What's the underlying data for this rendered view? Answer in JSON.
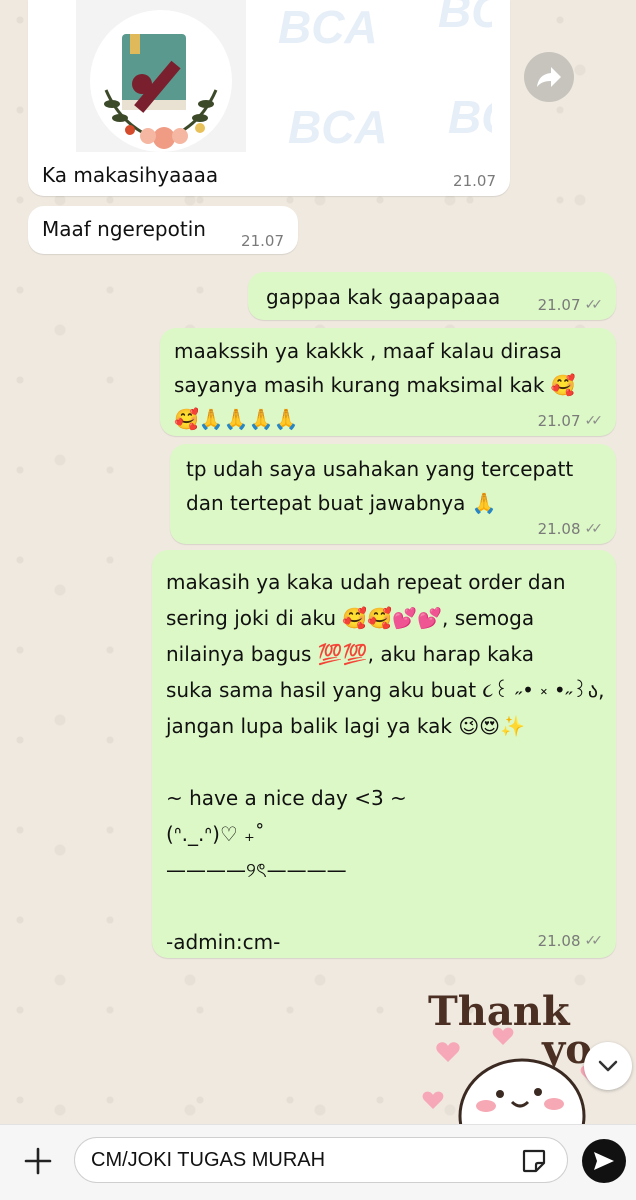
{
  "chat": {
    "messages": [
      {
        "direction": "in",
        "caption": "Ka makasihyaaaa",
        "time": "21.07",
        "image": {
          "watermark": "BCA"
        }
      },
      {
        "direction": "in",
        "text": "Maaf ngerepotin",
        "time": "21.07"
      },
      {
        "direction": "out",
        "text": "gappaa kak gaapapaaa",
        "time": "21.07",
        "status": "read"
      },
      {
        "direction": "out",
        "text": "maakssih ya kakkk , maaf kalau dirasa\nsayanya masih kurang maksimal kak 🥰\n🥰🙏🙏🙏🙏",
        "time": "21.07",
        "status": "read"
      },
      {
        "direction": "out",
        "text": "tp udah saya usahakan yang tercepatt\ndan tertepat buat jawabnya 🙏",
        "time": "21.08",
        "status": "read"
      },
      {
        "direction": "out",
        "text": "makasih ya kaka udah repeat order dan\nsering joki di aku 🥰🥰💕💕, semoga\nnilainya bagus 💯💯, aku harap kaka\nsuka sama hasil yang aku buat ૮꒰ ˶• ༝ •˶꒱ა,\njangan lupa balik lagi ya kak 😉😍✨\n\n~ have a nice day <3 ~\n(ᐢ._.ᐢ)♡ ₊˚\n————୨ৎ————\n\n-admin:cm-",
        "time": "21.08",
        "status": "read"
      }
    ],
    "sticker": {
      "line1": "Thank",
      "line2": "yo"
    }
  },
  "input": {
    "value": "CM/JOKI TUGAS MURAH"
  },
  "colors": {
    "incoming": "#ffffff",
    "outgoing": "#dcf8c6",
    "background": "#efeae2",
    "send_button": "#111111"
  },
  "icons": [
    "forward-icon",
    "plus-icon",
    "sticker-icon",
    "send-icon",
    "chevron-down-icon",
    "double-check-icon"
  ]
}
